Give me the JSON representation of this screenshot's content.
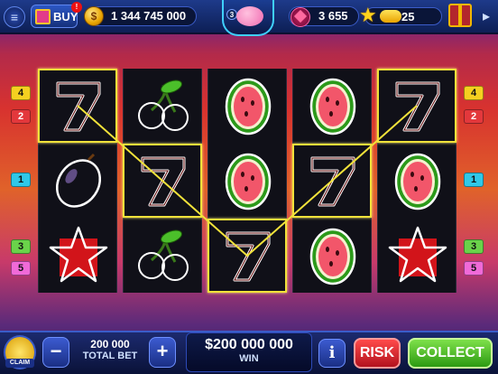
{
  "topbar": {
    "buy_label": "BUY",
    "buy_badge": "!",
    "coins": "1 344 745 000",
    "piggy_count": "3",
    "gems": "3 655",
    "level": "25",
    "level_progress": 0.35
  },
  "side_left": [
    "4",
    "2",
    "1",
    "3",
    "5"
  ],
  "side_right": [
    "4",
    "2",
    "1",
    "3",
    "5"
  ],
  "reels": [
    [
      "seven",
      "plum",
      "star"
    ],
    [
      "cherry",
      "seven",
      "cherry"
    ],
    [
      "watermelon",
      "watermelon",
      "seven"
    ],
    [
      "watermelon",
      "seven",
      "watermelon"
    ],
    [
      "seven",
      "watermelon",
      "star"
    ]
  ],
  "bottombar": {
    "claim_label": "CLAIM",
    "minus_label": "−",
    "plus_label": "+",
    "bet_value": "200 000",
    "bet_label": "TOTAL BET",
    "win_value": "$200 000 000",
    "win_label": "WIN",
    "info_label": "i",
    "risk_label": "RISK",
    "collect_label": "COLLECT"
  },
  "colors": {
    "payline": "#f1e23a",
    "risk": "#e0202e",
    "collect": "#4ec21e"
  }
}
